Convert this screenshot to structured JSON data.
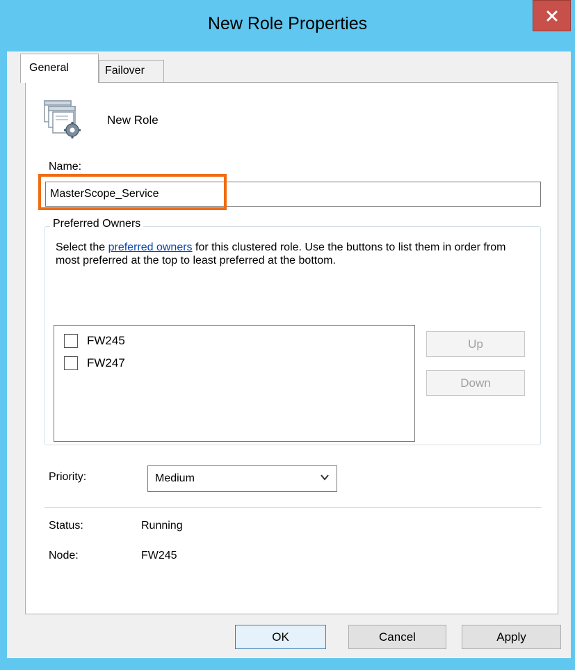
{
  "window": {
    "title": "New Role Properties",
    "close_label": "x"
  },
  "tabs": [
    {
      "label": "General",
      "active": true
    },
    {
      "label": "Failover",
      "active": false
    }
  ],
  "role": {
    "name": "New Role",
    "icon": "cluster-role-icon"
  },
  "name_field": {
    "label": "Name:",
    "value": "MasterScope_Service"
  },
  "preferred_owners": {
    "group_label": "Preferred Owners",
    "desc_before": "Select the ",
    "desc_link": "preferred owners",
    "desc_after": " for this clustered role. Use the buttons to list them in order from most preferred at the top to least preferred at the bottom.",
    "owners": [
      {
        "label": "FW245",
        "checked": false
      },
      {
        "label": "FW247",
        "checked": false
      }
    ],
    "up_label": "Up",
    "down_label": "Down"
  },
  "priority": {
    "label": "Priority:",
    "selected": "Medium"
  },
  "status": {
    "label": "Status:",
    "value": "Running"
  },
  "node": {
    "label": "Node:",
    "value": "FW245"
  },
  "buttons": {
    "ok": "OK",
    "cancel": "Cancel",
    "apply": "Apply"
  },
  "colors": {
    "titlebar": "#5fc7f0",
    "close_button": "#c7504b",
    "highlight_box": "#ef6c13",
    "link": "#0645ad"
  }
}
